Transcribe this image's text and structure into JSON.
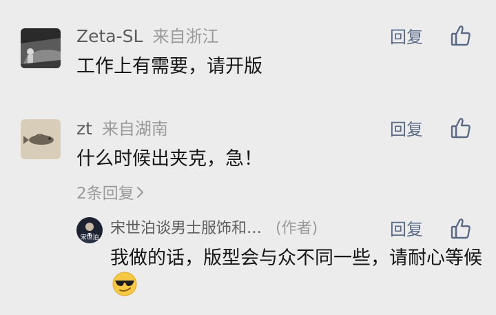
{
  "comments": [
    {
      "username": "Zeta-SL",
      "location": "来自浙江",
      "content": "工作上有需要，请开版",
      "reply_label": "回复"
    },
    {
      "username": "zt",
      "location": "来自湖南",
      "content": "什么时候出夹克，急！",
      "reply_label": "回复",
      "replies_toggle": "2条回复",
      "reply": {
        "username": "宋世泊谈男士服饰和…",
        "author_tag": "(作者)",
        "reply_label": "回复",
        "content": "我做的话，版型会与众不同一些，请耐心等候",
        "avatar_text": "宋世泊"
      }
    }
  ],
  "icons": {
    "like": "thumbs-up-icon",
    "chevron": "chevron-right-icon",
    "emoji": "cool-sunglasses-emoji"
  },
  "colors": {
    "background": "#ececec",
    "reply_link": "#5a6a86",
    "meta_text": "#9a9a9a"
  }
}
